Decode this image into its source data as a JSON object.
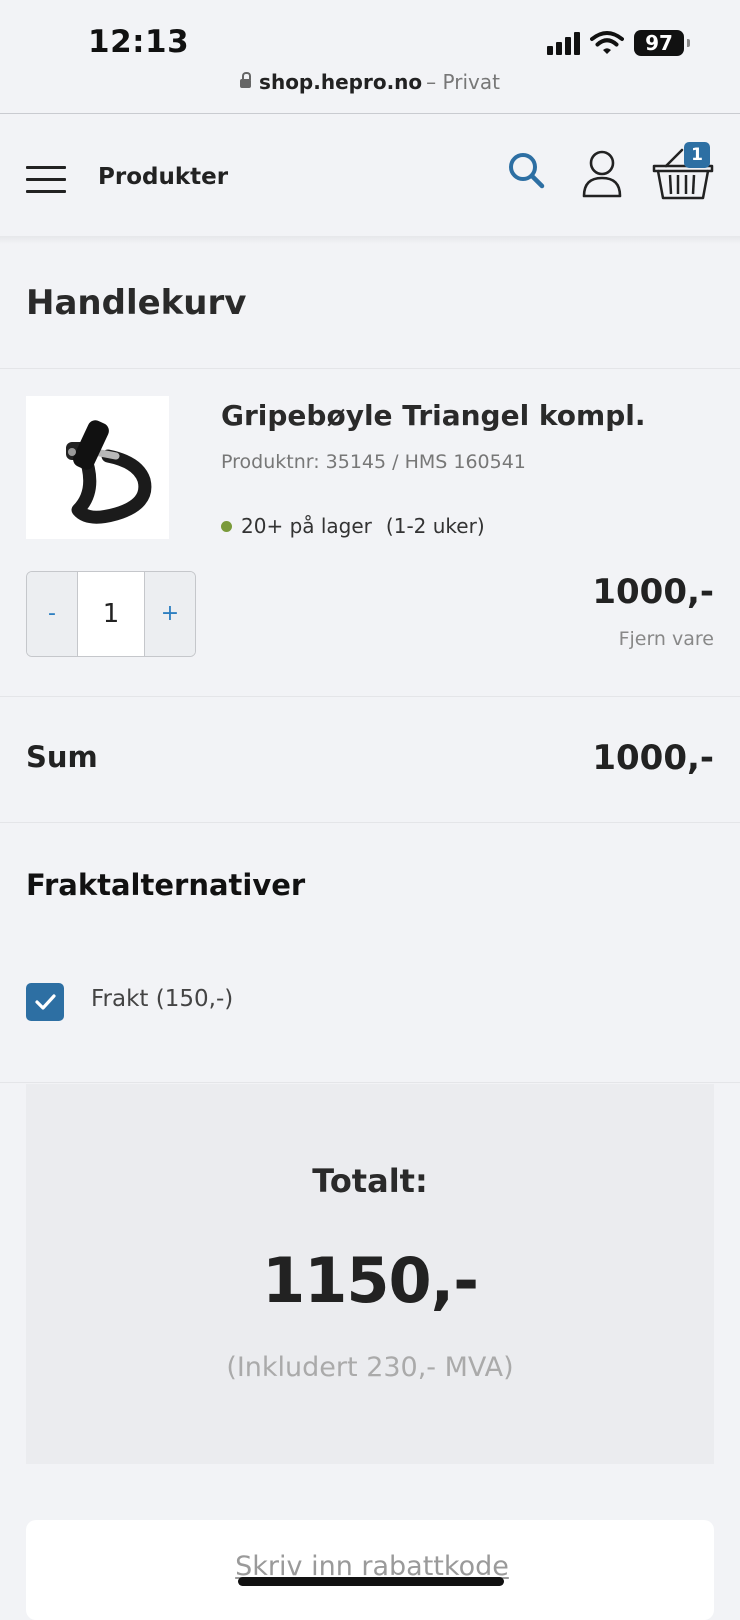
{
  "status_bar": {
    "time": "12:13",
    "battery": "97"
  },
  "browser": {
    "host": "shop.hepro.no",
    "mode": "– Privat"
  },
  "header": {
    "title": "Produkter",
    "cart_count": "1",
    "accent_color": "#2d6fa3"
  },
  "page": {
    "title": "Handlekurv"
  },
  "cart_item": {
    "name": "Gripebøyle Triangel kompl.",
    "product_number": "Produktnr: 35145 / HMS 160541",
    "stock": "20+ på lager",
    "stock_eta": "(1-2 uker)",
    "stock_color": "#7a9a3a",
    "quantity": "1",
    "minus_label": "-",
    "plus_label": "+",
    "price": "1000,-",
    "remove_label": "Fjern vare"
  },
  "summary": {
    "sum_label": "Sum",
    "sum_value": "1000,-"
  },
  "shipping": {
    "title": "Fraktalternativer",
    "option_label": "Frakt (150,-)",
    "option_checked": true
  },
  "total": {
    "label": "Totalt:",
    "value": "1150,-",
    "vat": "(Inkludert 230,- MVA)"
  },
  "coupon": {
    "placeholder": "Skriv inn rabattkode"
  }
}
